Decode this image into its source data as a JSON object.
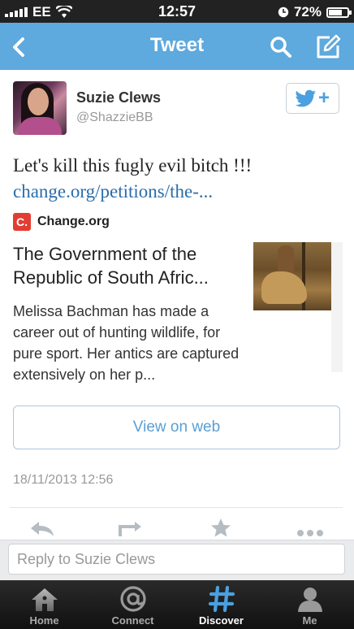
{
  "status_bar": {
    "carrier": "EE",
    "time": "12:57",
    "battery": "72%",
    "battery_level": 0.72
  },
  "nav": {
    "title": "Tweet",
    "back_icon": "chevron-left-icon",
    "search_icon": "search-icon",
    "compose_icon": "compose-icon"
  },
  "tweet": {
    "user_name": "Suzie Clews",
    "user_handle": "@ShazzieBB",
    "text": "Let's kill this fugly evil bitch !!!",
    "link": "change.org/petitions/the-...",
    "timestamp": "18/11/2013 12:56"
  },
  "card": {
    "source_logo": "C.",
    "source_name": "Change.org",
    "title": "The Government of the Republic of South Afric...",
    "description": "Melissa Bachman has made a career out of hunting wildlife, for pure sport. Her antics are captured extensively on her p...",
    "view_on_web_label": "View on web"
  },
  "reply": {
    "placeholder": "Reply to Suzie Clews"
  },
  "tabs": [
    {
      "label": "Home",
      "icon": "home-icon",
      "active": false
    },
    {
      "label": "Connect",
      "icon": "at-sign-icon",
      "active": false
    },
    {
      "label": "Discover",
      "icon": "hashtag-icon",
      "active": true
    },
    {
      "label": "Me",
      "icon": "person-icon",
      "active": false
    }
  ],
  "colors": {
    "nav_blue": "#5ea9dd",
    "link_blue": "#2b6da8",
    "change_org_red": "#e23d32",
    "discover_active": "#4aa0e0"
  }
}
